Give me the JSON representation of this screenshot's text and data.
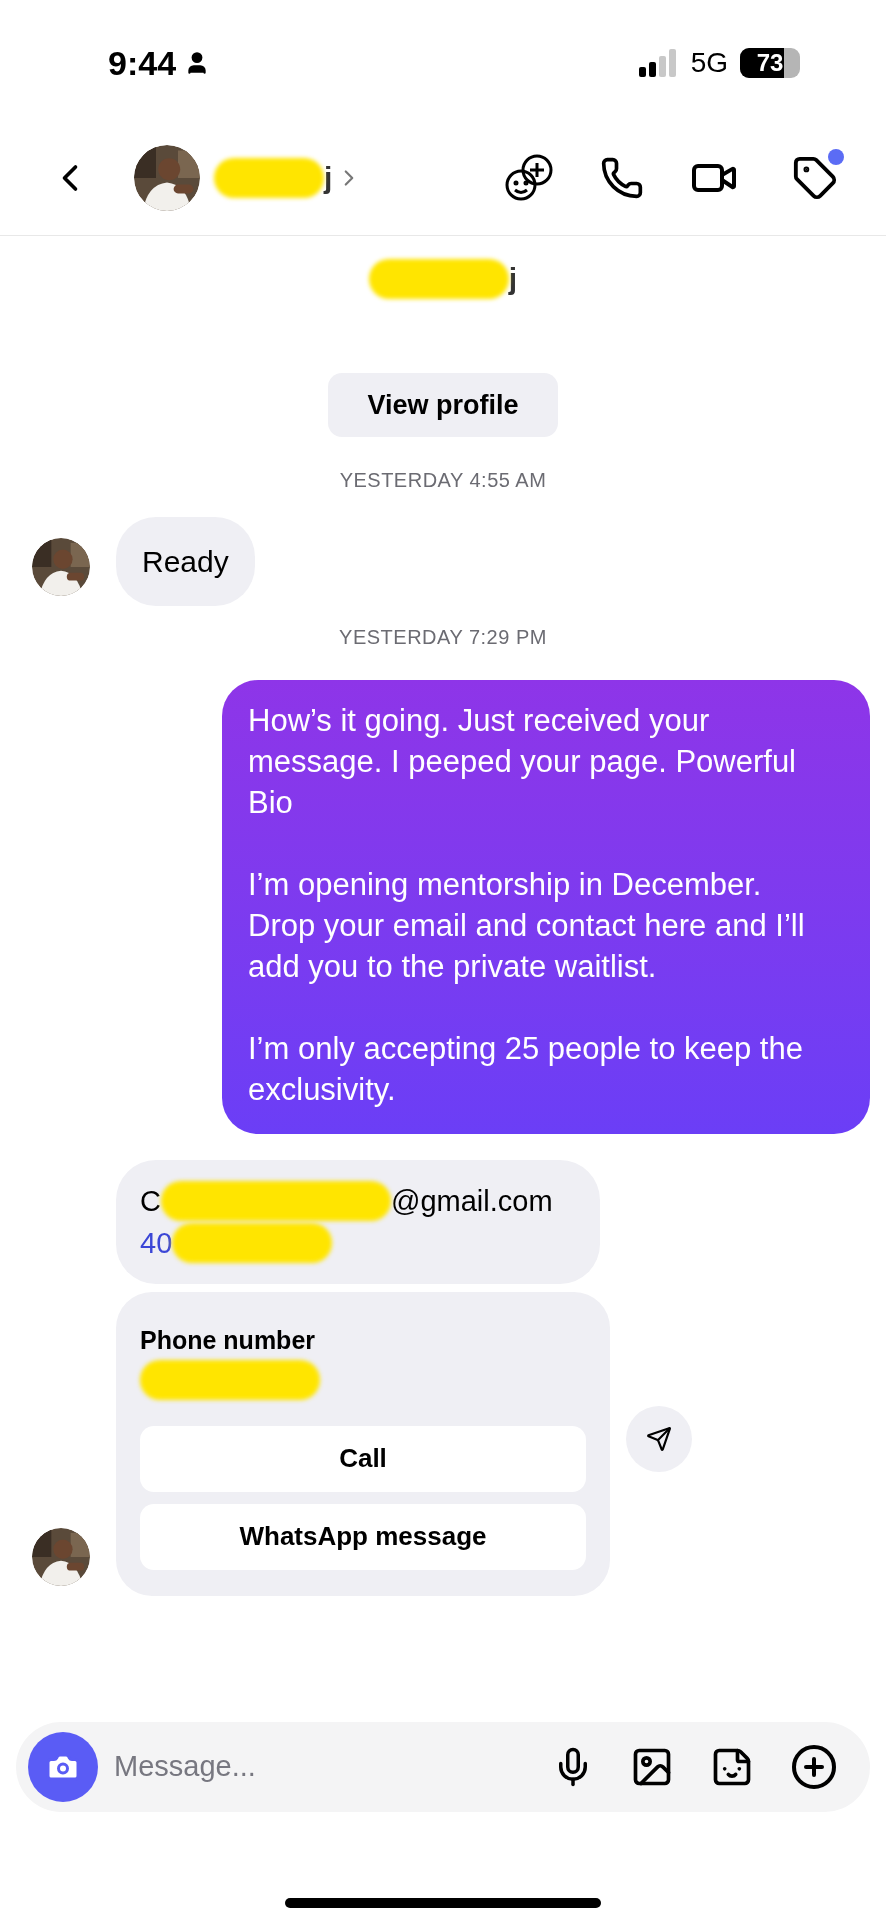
{
  "status_bar": {
    "time": "9:44",
    "network": "5G",
    "battery": "73"
  },
  "header": {
    "name_visible": "j",
    "has_notification": true
  },
  "profile": {
    "name_visible": "j",
    "button": "View profile"
  },
  "messages": [
    {
      "kind": "timestamp",
      "text": "YESTERDAY 4:55 AM"
    },
    {
      "kind": "incoming",
      "text": "Ready",
      "avatar": true
    },
    {
      "kind": "timestamp",
      "text": "YESTERDAY 7:29 PM"
    },
    {
      "kind": "outgoing",
      "paragraphs": [
        "How’s it going. Just received your message. I peeped your page. Powerful Bio",
        "I’m opening mentorship in December. Drop your email and contact here and I’ll add you to the private waitlist.",
        "I’m only accepting 25 people to keep the exclusivity."
      ]
    },
    {
      "kind": "contact",
      "email_start": "C",
      "email_end": "@gmail.com",
      "phone_start": "40"
    },
    {
      "kind": "phone_card",
      "title": "Phone number",
      "actions": [
        "Call",
        "WhatsApp message"
      ],
      "avatar": true
    }
  ],
  "composer": {
    "placeholder": "Message..."
  }
}
